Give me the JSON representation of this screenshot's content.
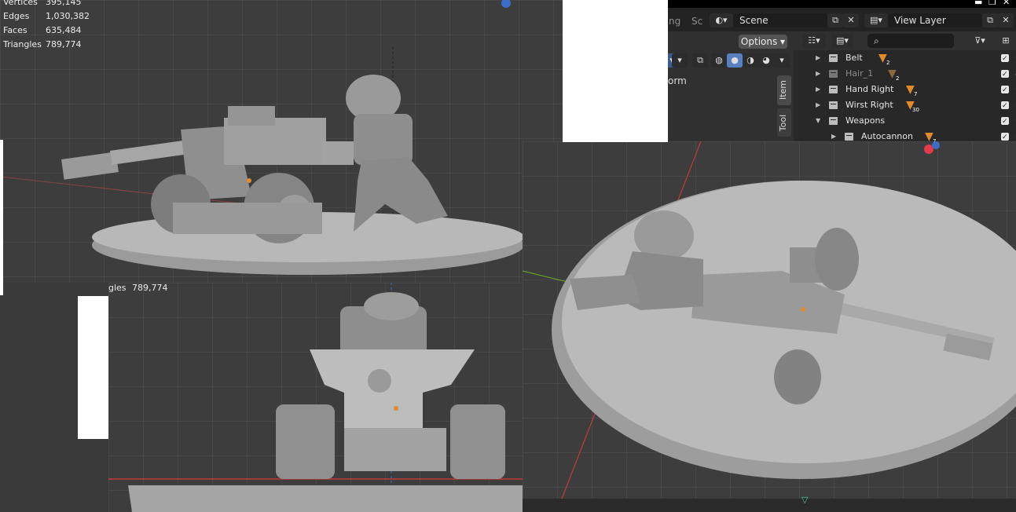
{
  "stats": {
    "vertices_label": "Vertices",
    "vertices_value": "395,145",
    "edges_label": "Edges",
    "edges_value": "1,030,382",
    "faces_label": "Faces",
    "faces_value": "635,484",
    "triangles_label": "Triangles",
    "triangles_value": "789,774"
  },
  "front_stats": {
    "label": "gles",
    "value": "789,774"
  },
  "header": {
    "tab_partial_1": "ng",
    "tab_partial_2": "Sc",
    "scene_label": "Scene",
    "view_layer_label": "View Layer",
    "options_label": "Options",
    "transform_partial": "orm"
  },
  "sidebar_tabs": {
    "item": "Item",
    "tool": "Tool"
  },
  "outliner": {
    "rows": [
      {
        "name": "Belt",
        "count": "2"
      },
      {
        "name": "Hair_1",
        "count": "2"
      },
      {
        "name": "Hand Right",
        "count": "7"
      },
      {
        "name": "Wirst Right",
        "count": "30"
      },
      {
        "name": "Weapons",
        "count": ""
      },
      {
        "name": "Autocannon",
        "count": "7"
      }
    ]
  },
  "colors": {
    "viewport_bg": "#3d3d3d",
    "model_gray": "#a8a8a8",
    "x_axis": "#c23b3b",
    "y_axis": "#6b9a2a",
    "origin_dot": "#e68a2e"
  }
}
